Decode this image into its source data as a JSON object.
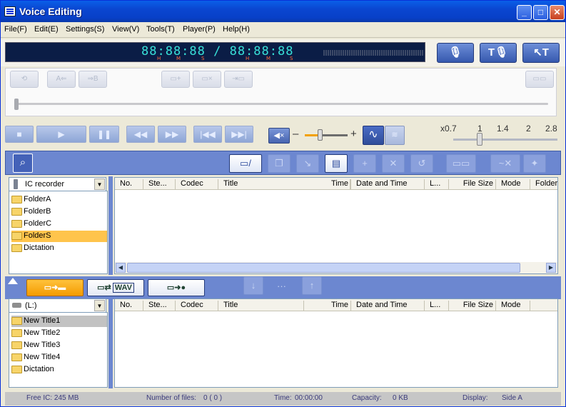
{
  "window": {
    "title": "Voice Editing",
    "min": "_",
    "max": "□",
    "close": "✕"
  },
  "menu": [
    "File(F)",
    "Edit(E)",
    "Settings(S)",
    "View(V)",
    "Tools(T)",
    "Player(P)",
    "Help(H)"
  ],
  "display": {
    "time": "88:88:88 / 88:88:88",
    "hms": [
      "H",
      "M",
      "S",
      "H",
      "M",
      "S"
    ]
  },
  "top_buttons": {
    "record": "🎙",
    "to_text": "T🎙",
    "edit_text": "↖T"
  },
  "speed": {
    "labels": [
      "x0.7",
      "1",
      "1.4",
      "2",
      "2.8"
    ],
    "value": 1.0
  },
  "volume": {
    "level": 0.3
  },
  "upper": {
    "device": "IC recorder",
    "folders": [
      "FolderA",
      "FolderB",
      "FolderC",
      "FolderS",
      "Dictation"
    ],
    "selected_folder": "FolderS",
    "columns": [
      "No.",
      "Ste...",
      "Codec",
      "Title",
      "Time",
      "Date and Time",
      "L...",
      "File Size",
      "Mode",
      "Folder"
    ]
  },
  "lower": {
    "drive": "(L:)",
    "folders": [
      "New Title1",
      "New Title2",
      "New Title3",
      "New Title4",
      "Dictation"
    ],
    "selected_folder": "New Title1",
    "columns": [
      "No.",
      "Ste...",
      "Codec",
      "Title",
      "Time",
      "Date and Time",
      "L...",
      "File Size",
      "Mode"
    ],
    "wav_label": "WAV",
    "dots": "···"
  },
  "status": {
    "free": "Free IC: 245 MB",
    "files_label": "Number of files:",
    "files_value": "0 ( 0 )",
    "time_label": "Time:",
    "time_value": "00:00:00",
    "capacity_label": "Capacity:",
    "capacity_value": "0 KB",
    "display_label": "Display:",
    "display_value": "Side A"
  }
}
